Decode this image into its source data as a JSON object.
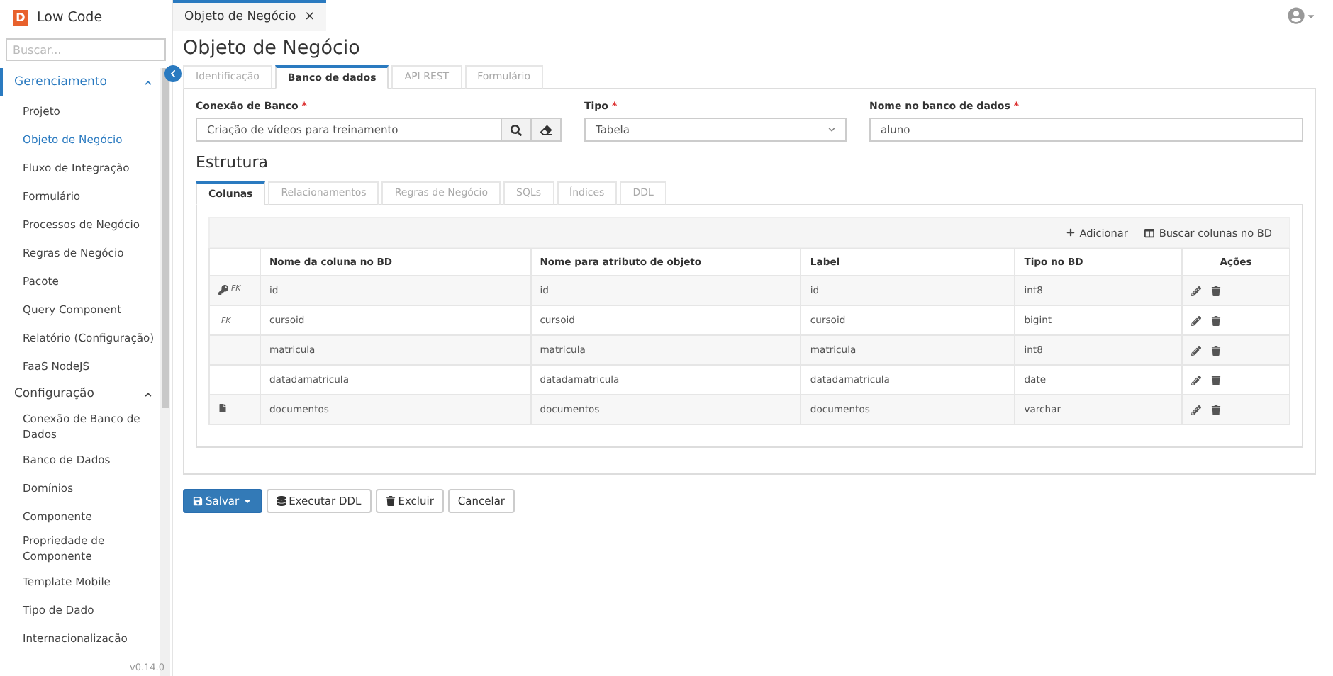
{
  "app": {
    "logo_letter": "D",
    "name": "Low Code",
    "version": "v0.14.0"
  },
  "sidebar": {
    "search_placeholder": "Buscar...",
    "sections": [
      {
        "label": "Gerenciamento",
        "expanded": true,
        "selected": true,
        "items": [
          {
            "label": "Projeto",
            "selected": false
          },
          {
            "label": "Objeto de Negócio",
            "selected": true
          },
          {
            "label": "Fluxo de Integração",
            "selected": false
          },
          {
            "label": "Formulário",
            "selected": false
          },
          {
            "label": "Processos de Negócio",
            "selected": false
          },
          {
            "label": "Regras de Negócio",
            "selected": false
          },
          {
            "label": "Pacote",
            "selected": false
          },
          {
            "label": "Query Component",
            "selected": false
          },
          {
            "label": "Relatório (Configuração)",
            "selected": false
          },
          {
            "label": "FaaS NodeJS",
            "selected": false
          }
        ]
      },
      {
        "label": "Configuração",
        "expanded": true,
        "selected": false,
        "items": [
          {
            "label": "Conexão de Banco de Dados",
            "selected": false
          },
          {
            "label": "Banco de Dados",
            "selected": false
          },
          {
            "label": "Domínios",
            "selected": false
          },
          {
            "label": "Componente",
            "selected": false
          },
          {
            "label": "Propriedade de Componente",
            "selected": false
          },
          {
            "label": "Template Mobile",
            "selected": false
          },
          {
            "label": "Tipo de Dado",
            "selected": false
          },
          {
            "label": "Internacionalizacão",
            "selected": false
          }
        ]
      }
    ]
  },
  "open_tabs": [
    {
      "label": "Objeto de Negócio",
      "close": "×",
      "selected": true
    }
  ],
  "page_title": "Objeto de Negócio",
  "tabs": [
    {
      "label": "Identificação",
      "selected": false
    },
    {
      "label": "Banco de dados",
      "selected": true
    },
    {
      "label": "API REST",
      "selected": false
    },
    {
      "label": "Formulário",
      "selected": false
    }
  ],
  "form": {
    "connection": {
      "label": "Conexão de Banco",
      "required": "*",
      "value": "Criação de vídeos para treinamento"
    },
    "type": {
      "label": "Tipo",
      "required": "*",
      "value": "Tabela"
    },
    "db_name": {
      "label": "Nome no banco de dados",
      "required": "*",
      "value": "aluno"
    }
  },
  "structure": {
    "title": "Estrutura",
    "tabs": [
      {
        "label": "Colunas",
        "selected": true
      },
      {
        "label": "Relacionamentos",
        "selected": false
      },
      {
        "label": "Regras de Negócio",
        "selected": false
      },
      {
        "label": "SQLs",
        "selected": false
      },
      {
        "label": "Índices",
        "selected": false
      },
      {
        "label": "DDL",
        "selected": false
      }
    ],
    "actions": [
      "Adicionar",
      "Buscar colunas no BD"
    ],
    "columns": [
      "Nome da coluna no BD",
      "Nome para atributo de objeto",
      "Label",
      "Tipo no BD",
      "Ações"
    ],
    "rows": [
      {
        "key": true,
        "fk": "FK",
        "document": false,
        "cells": [
          "id",
          "id",
          "id",
          "int8"
        ]
      },
      {
        "key": false,
        "fk": "FK",
        "document": false,
        "cells": [
          "cursoid",
          "cursoid",
          "cursoid",
          "bigint"
        ]
      },
      {
        "key": false,
        "document": false,
        "cells": [
          "matricula",
          "matricula",
          "matricula",
          "int8"
        ]
      },
      {
        "key": false,
        "document": false,
        "cells": [
          "datadamatricula",
          "datadamatricula",
          "datadamatricula",
          "date"
        ]
      },
      {
        "key": false,
        "document": true,
        "cells": [
          "documentos",
          "documentos",
          "documentos",
          "varchar"
        ]
      }
    ]
  },
  "buttons": [
    {
      "label": "Salvar",
      "kind": "primary"
    },
    {
      "label": "Executar DDL",
      "kind": "ddl"
    },
    {
      "label": "Excluir",
      "kind": "delete"
    },
    {
      "label": "Cancelar",
      "kind": "plain"
    }
  ]
}
